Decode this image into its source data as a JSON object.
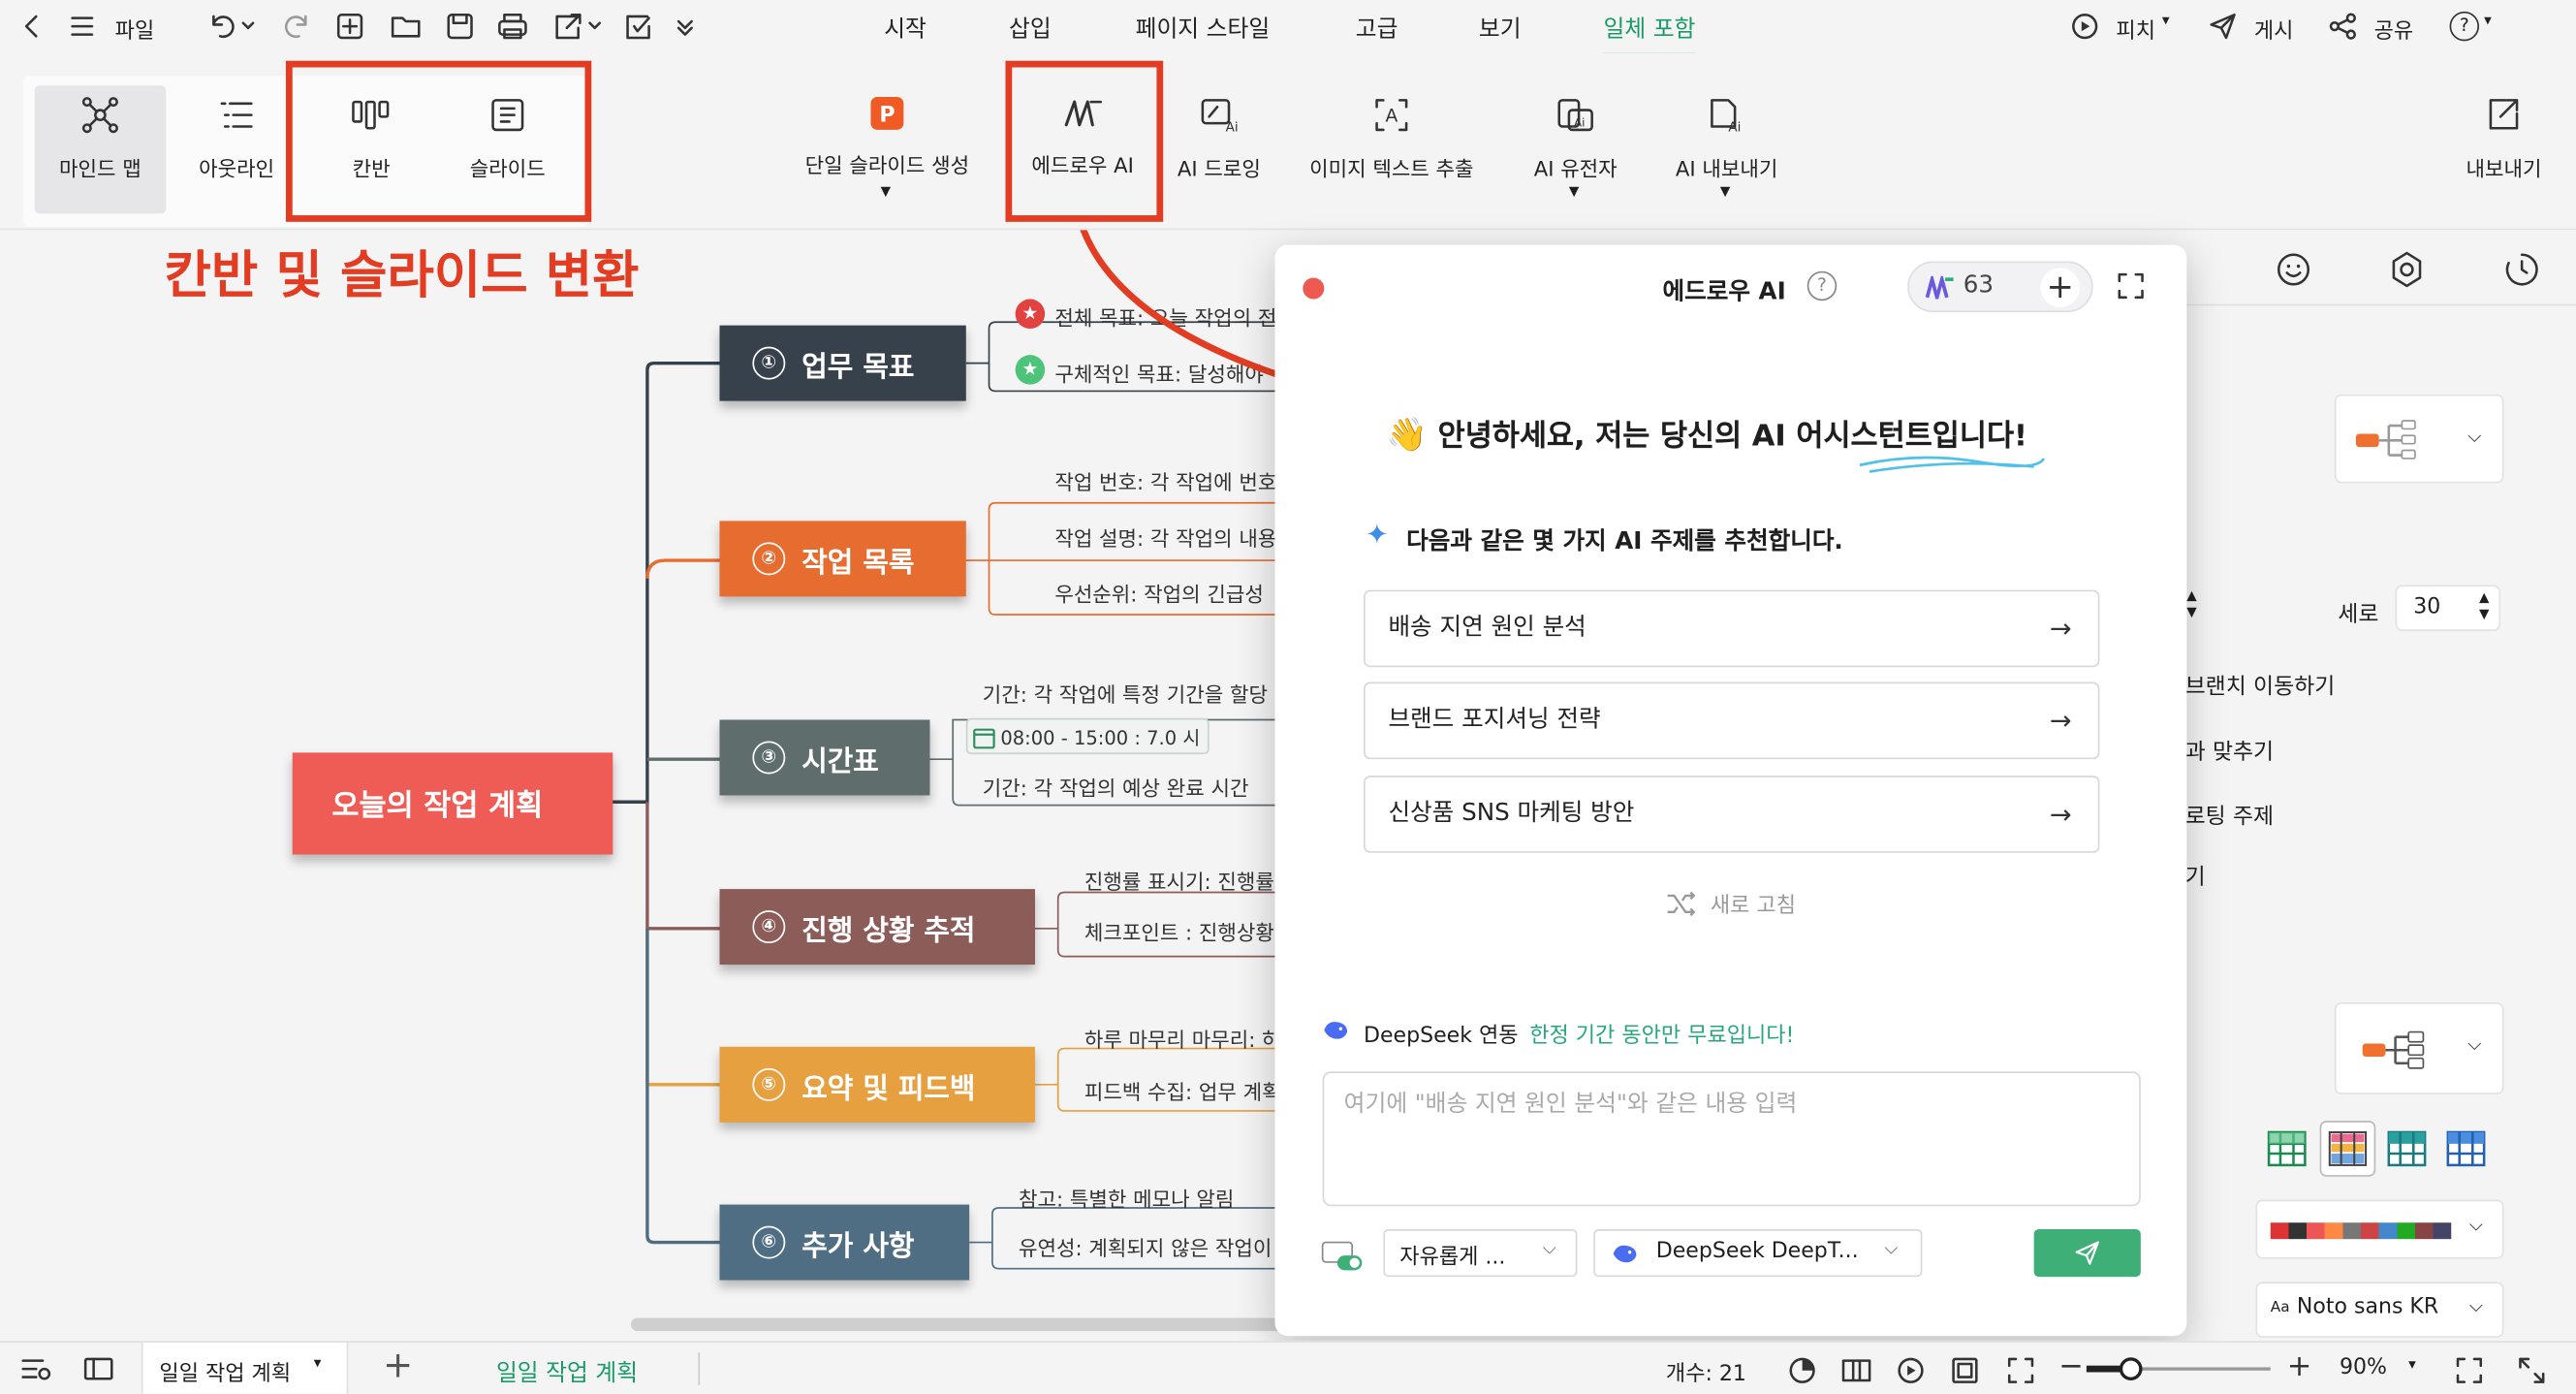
{
  "titlebar": {
    "file_label": "파일"
  },
  "menu": {
    "items": [
      {
        "label": "시작"
      },
      {
        "label": "삽입"
      },
      {
        "label": "페이지 스타일"
      },
      {
        "label": "고급"
      },
      {
        "label": "보기"
      },
      {
        "label": "일체 포함"
      }
    ],
    "active": "일체 포함",
    "pitch": "피치",
    "publish": "게시",
    "share": "공유",
    "help": "?"
  },
  "ribbon": {
    "mind_map": "마인드 맵",
    "outline": "아웃라인",
    "kanban": "칸반",
    "slide": "슬라이드",
    "single_slide": "단일 슬라이드 생성",
    "edraw_ai": "에드로우 AI",
    "ai_drawing": "AI 드로잉",
    "image_text": "이미지 텍스트 추출",
    "ai_gene": "AI 유전자",
    "ai_export": "AI 내보내기",
    "export": "내보내기"
  },
  "annotation": {
    "text": "칸반 및 슬라이드 변환",
    "color": "#e23d23"
  },
  "mindmap": {
    "root": "오늘의 작업 계획",
    "branches": [
      {
        "num": "①",
        "label": "업무 목표",
        "color": "#36414b",
        "subs": [
          "전체 목표: 오늘 작업의 전",
          "구체적인 목표: 달성해야"
        ]
      },
      {
        "num": "②",
        "label": "작업 목록",
        "color": "#e76c2f",
        "subs": [
          "작업 번호: 각 작업에 번호",
          "작업 설명: 각 작업의 내용",
          "우선순위: 작업의 긴급성"
        ]
      },
      {
        "num": "③",
        "label": "시간표",
        "color": "#5f6d6d",
        "subs": [
          "기간: 각 작업에 특정 기간을 할당",
          "08:00 - 15:00 : 7.0 시",
          "기간: 각 작업의 예상 완료 시간"
        ]
      },
      {
        "num": "④",
        "label": "진행 상황 추적",
        "color": "#8b5c58",
        "subs": [
          "진행률 표시기: 진행률",
          "체크포인트 : 진행상황"
        ]
      },
      {
        "num": "⑤",
        "label": "요약 및 피드백",
        "color": "#e6a040",
        "subs": [
          "하루 마무리 마무리: 하",
          "피드백 수집: 업무 계획"
        ]
      },
      {
        "num": "⑥",
        "label": "추가 사항",
        "color": "#4f6e84",
        "subs": [
          "참고: 특별한 메모나 알림",
          "유연성: 계획되지 않은 작업이"
        ]
      }
    ]
  },
  "ai_panel": {
    "title": "에드로우 AI",
    "credits": "63",
    "greeting_prefix": "안녕하세요, 저는 당신의 AI ",
    "greeting_highlight": "어시스턴트",
    "greeting_suffix": "입니다!",
    "recommend": "다음과 같은 몇 가지 AI 주제를 추천합니다.",
    "topics": [
      "배송 지연 원인 분석",
      "브랜드 포지셔닝 전략",
      "신상품 SNS 마케팅 방안"
    ],
    "refresh": "새로 고침",
    "deepseek_label": "DeepSeek 연동",
    "deepseek_promo": "한정 기간 동안만 무료입니다!",
    "input_placeholder": "여기에 \"배송 지연 원인 분석\"와 같은 내용 입력",
    "mode_select": "자유롭게 ...",
    "model_select": "DeepSeek DeepT...",
    "accent": "#3faf78"
  },
  "right_panel": {
    "height_label": "세로",
    "height_value": "30",
    "opt1": "브랜치 이동하기",
    "opt2": "과 맞추기",
    "opt3": "로팅 주제",
    "opt4": "기",
    "font": "Noto sans KR"
  },
  "statusbar": {
    "doc_tab": "일일 작업 계획",
    "page_tab": "일일 작업 계획",
    "count": "개수: 21",
    "zoom": "90%"
  }
}
